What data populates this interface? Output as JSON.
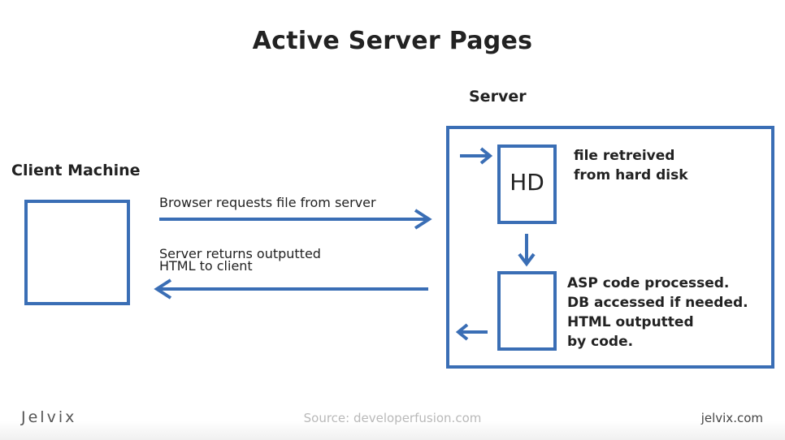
{
  "title": "Active Server Pages",
  "client": {
    "heading": "Client Machine"
  },
  "server": {
    "heading": "Server",
    "hd_label": "HD",
    "hd_description": [
      "file retreived",
      "from hard disk"
    ],
    "processor_description": [
      "ASP code processed.",
      "DB accessed if needed.",
      "HTML outputted",
      "by code."
    ]
  },
  "arrows": {
    "request_label": "Browser requests file from server",
    "response_label": [
      "Server returns outputted",
      "HTML to client"
    ]
  },
  "colors": {
    "accent": "#3a6eb5",
    "text": "#222222",
    "source_text": "#b9b9b9"
  },
  "footer": {
    "brand": "Jelvix",
    "source": "Source: developerfusion.com",
    "site": "jelvix.com"
  }
}
